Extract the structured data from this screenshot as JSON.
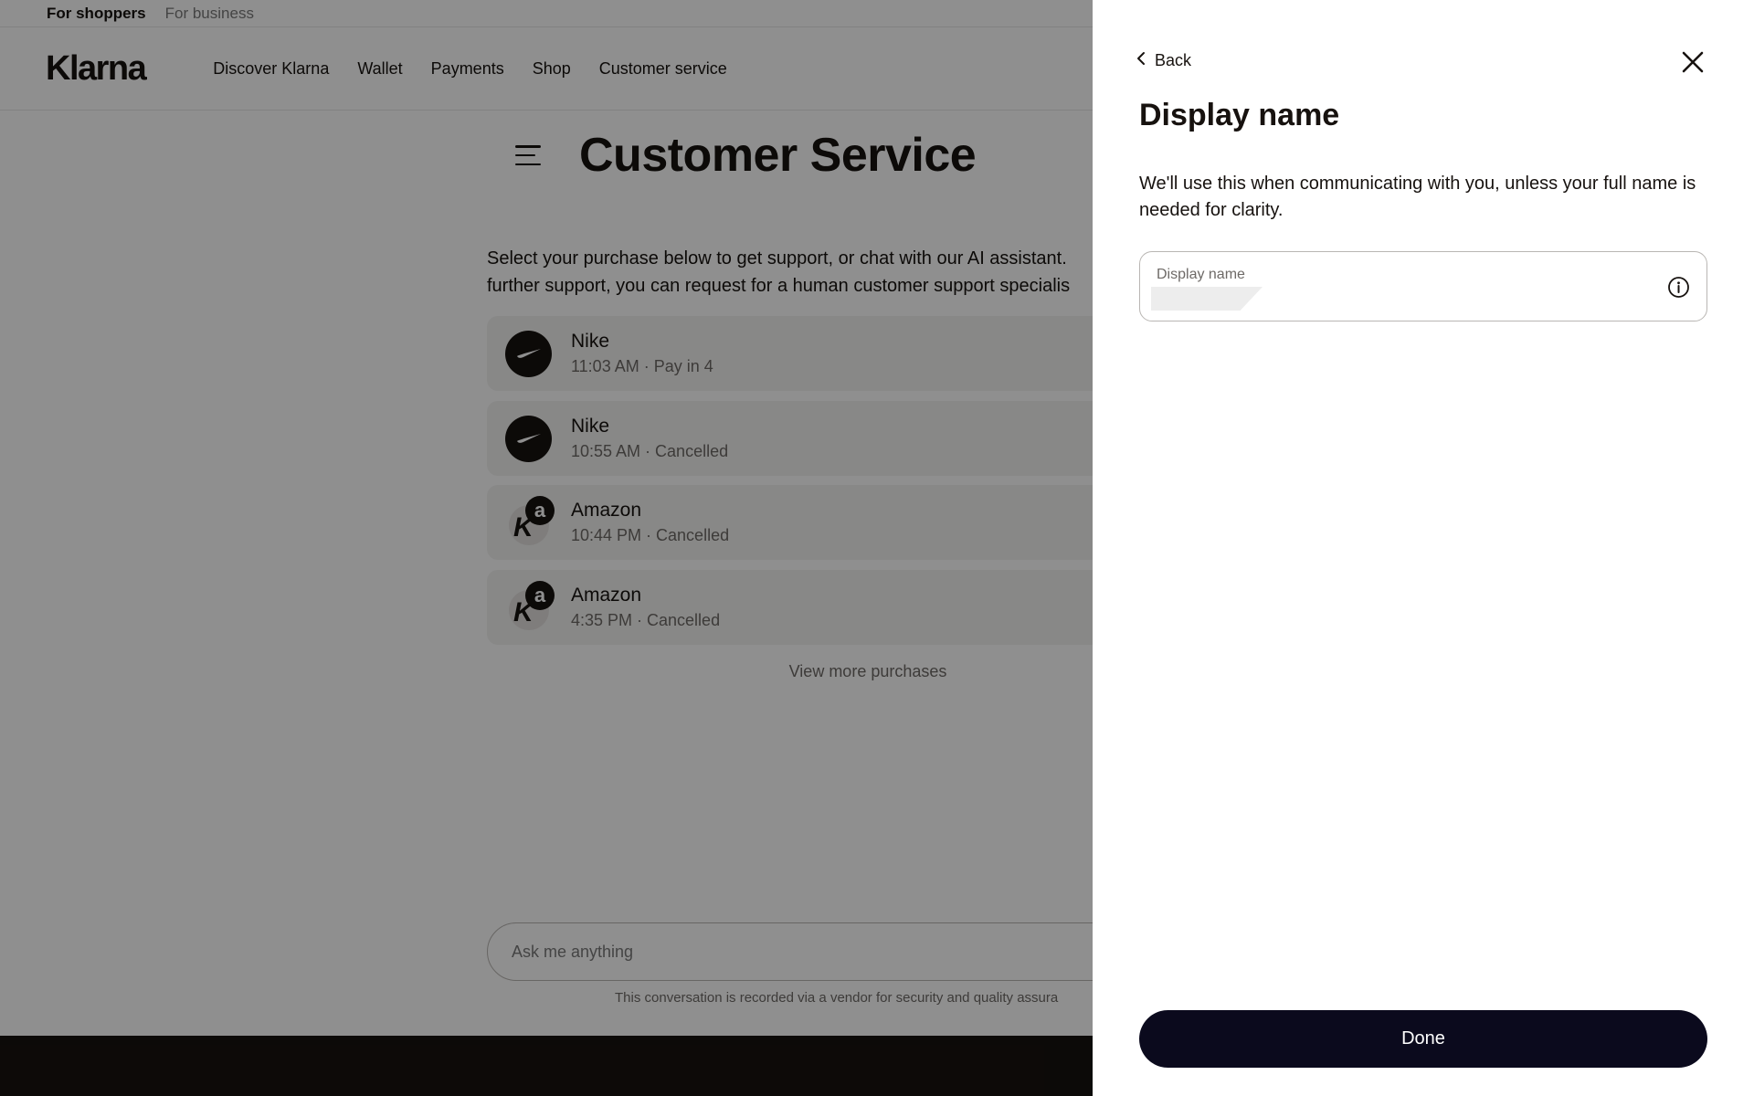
{
  "topbar": {
    "shoppers": "For shoppers",
    "business": "For business"
  },
  "header": {
    "logo": "Klarna",
    "nav": [
      "Discover Klarna",
      "Wallet",
      "Payments",
      "Shop",
      "Customer service"
    ]
  },
  "main": {
    "title": "Customer Service",
    "intro_line1": "Select your purchase below to get support, or chat with our AI assistant.",
    "intro_line2": "further support, you can request for a human customer support specialis",
    "purchases": [
      {
        "merchant": "Nike",
        "detail": "11:03 AM · Pay in 4",
        "logo": "nike-swoosh-icon"
      },
      {
        "merchant": "Nike",
        "detail": "10:55 AM · Cancelled",
        "logo": "nike-swoosh-icon"
      },
      {
        "merchant": "Amazon",
        "detail": "10:44 PM · Cancelled",
        "logo": "amazon-logo-icon"
      },
      {
        "merchant": "Amazon",
        "detail": "4:35 PM · Cancelled",
        "logo": "amazon-logo-icon"
      }
    ],
    "view_more": "View more purchases",
    "ask_placeholder": "Ask me anything",
    "recorded_note": "This conversation is recorded via a vendor for security and quality assura"
  },
  "panel": {
    "back_label": "Back",
    "title": "Display name",
    "description": "We'll use this when communicating with you, unless your full name is needed for clarity.",
    "field_label": "Display name",
    "field_value": "",
    "done_label": "Done"
  },
  "colors": {
    "text": "#17120f",
    "muted": "#6e6a67",
    "card_bg": "#f3f2f1",
    "done_button": "#0b0a1d",
    "footer": "#17120f"
  }
}
